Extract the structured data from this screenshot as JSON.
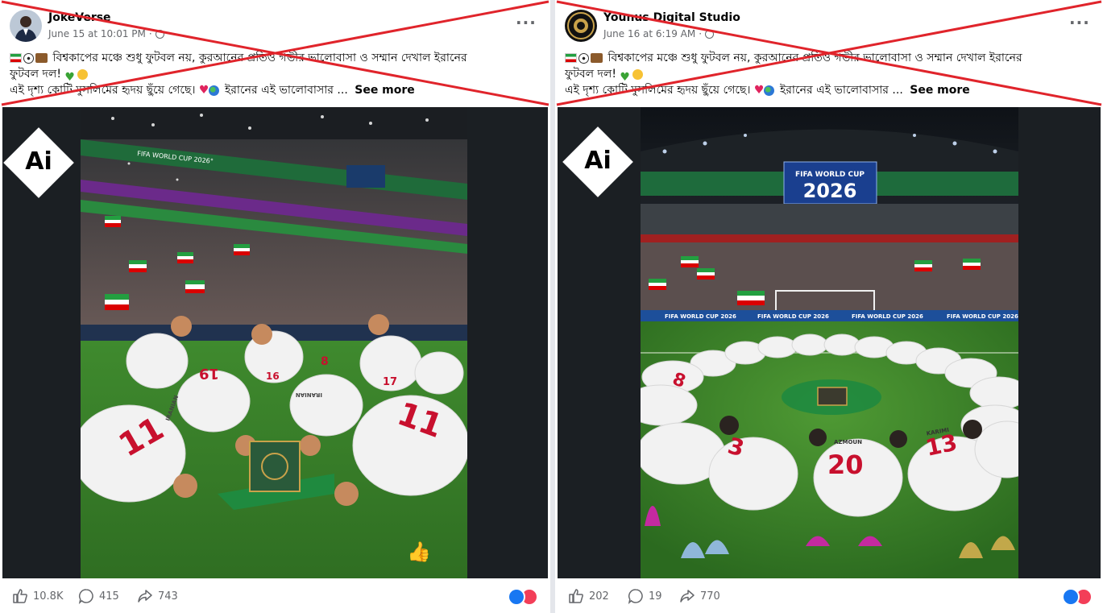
{
  "posts": [
    {
      "author": "JokeVerse",
      "date": "June 15 at 10:01 PM",
      "privacy_sep": "·",
      "caption_line1": "বিশ্বকাপের মঞ্চে শুধু ফুটবল নয়, কুরআনের প্রতিও গভীর ভালোবাসা ও সম্মান দেখাল ইরানের",
      "caption_line2": "ফুটবল দল!",
      "caption_line3": "এই দৃশ্য কোটি মুসলিমের হৃদয় ছুঁয়ে গেছে।",
      "caption_line3b": "ইরানের এই ভালোবাসার ...",
      "see_more": "See more",
      "ai_badge": "Ai",
      "likes": "10.8K",
      "comments": "415",
      "shares": "743",
      "photo_banner": "FIFA WORLD CUP 2026°",
      "jerseys": [
        "11",
        "16",
        "8",
        "17",
        "19",
        "11"
      ],
      "jersey_names": [
        "IRANIAN",
        "IRANIAN"
      ]
    },
    {
      "author": "Younus Digital Studio",
      "date": "June 16 at 6:19 AM",
      "privacy_sep": "·",
      "caption_line1": "বিশ্বকাপের মঞ্চে শুধু ফুটবল নয়, কুরআনের প্রতিও গভীর ভালোবাসা ও সম্মান দেখাল ইরানের",
      "caption_line2": "ফুটবল দল!",
      "caption_line3": "এই দৃশ্য কোটি মুসলিমের হৃদয় ছুঁয়ে গেছে।",
      "caption_line3b": "ইরানের এই ভালোবাসার ...",
      "see_more": "See more",
      "ai_badge": "Ai",
      "likes": "202",
      "comments": "19",
      "shares": "770",
      "screen_line1": "FIFA WORLD CUP",
      "screen_line2": "2026",
      "board_text": "FIFA WORLD CUP 2026",
      "jerseys": [
        "8",
        "3",
        "20",
        "13"
      ],
      "jersey_names": [
        "AZMOUN",
        "KARIMI"
      ]
    }
  ],
  "colors": {
    "cross_red": "#e0242b",
    "fb_blue": "#1877f2",
    "love_red": "#f33e58",
    "iran_green": "#239f40",
    "iran_red": "#da0000"
  }
}
